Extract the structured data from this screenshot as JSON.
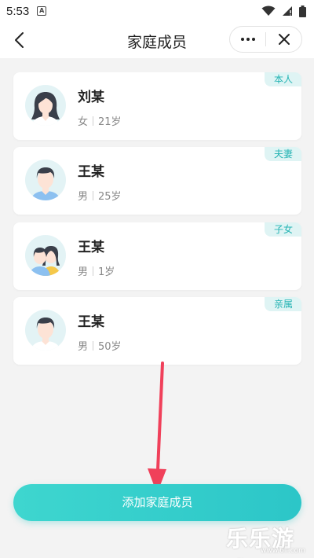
{
  "status_bar": {
    "time": "5:53"
  },
  "nav": {
    "title": "家庭成员"
  },
  "members": [
    {
      "name": "刘某",
      "gender": "女",
      "age": "21岁",
      "tag": "本人"
    },
    {
      "name": "王某",
      "gender": "男",
      "age": "25岁",
      "tag": "夫妻"
    },
    {
      "name": "王某",
      "gender": "男",
      "age": "1岁",
      "tag": "子女"
    },
    {
      "name": "王某",
      "gender": "男",
      "age": "50岁",
      "tag": "亲属"
    }
  ],
  "add_button": {
    "label": "添加家庭成员"
  },
  "watermark": {
    "text": "乐乐游戏",
    "url": "www.6ll.com"
  },
  "colors": {
    "accent": "#2cc6c8",
    "tag_bg": "#dff4f4",
    "tag_text": "#24b3b3",
    "arrow": "#f0405a"
  }
}
